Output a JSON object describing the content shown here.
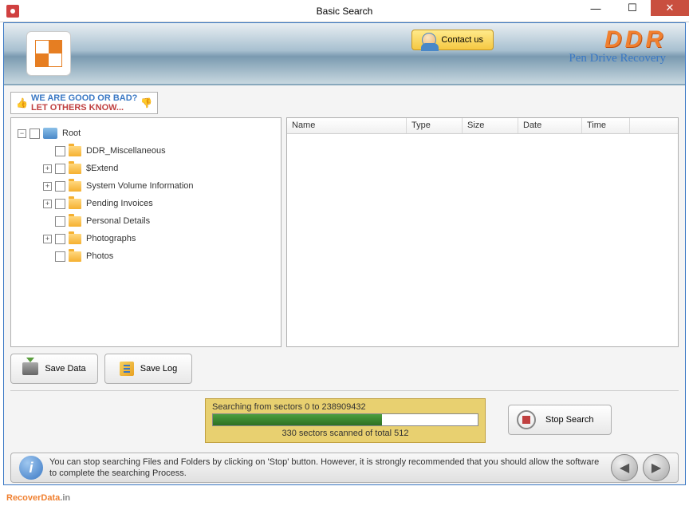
{
  "window": {
    "title": "Basic Search"
  },
  "header": {
    "contact_label": "Contact us",
    "brand": "DDR",
    "brand_sub": "Pen Drive Recovery"
  },
  "rating": {
    "line1": "WE ARE GOOD OR BAD?",
    "line2": "LET OTHERS KNOW..."
  },
  "tree": {
    "root": "Root",
    "items": [
      {
        "label": "DDR_Miscellaneous",
        "expandable": false
      },
      {
        "label": "$Extend",
        "expandable": true
      },
      {
        "label": "System Volume Information",
        "expandable": true
      },
      {
        "label": "Pending Invoices",
        "expandable": true
      },
      {
        "label": "Personal Details",
        "expandable": false
      },
      {
        "label": "Photographs",
        "expandable": true
      },
      {
        "label": "Photos",
        "expandable": false
      }
    ]
  },
  "list": {
    "columns": [
      "Name",
      "Type",
      "Size",
      "Date",
      "Time"
    ]
  },
  "actions": {
    "save_data": "Save Data",
    "save_log": "Save Log"
  },
  "progress": {
    "searching": "Searching from sectors 0 to 238909432",
    "status": "330  sectors scanned of total 512"
  },
  "stop": {
    "label": "Stop Search"
  },
  "info": {
    "text": "You can stop searching Files and Folders by clicking on 'Stop' button. However, it is strongly recommended that you should allow the software to complete the searching Process."
  },
  "footer": {
    "brand": "RecoverData",
    "tld": ".in"
  }
}
